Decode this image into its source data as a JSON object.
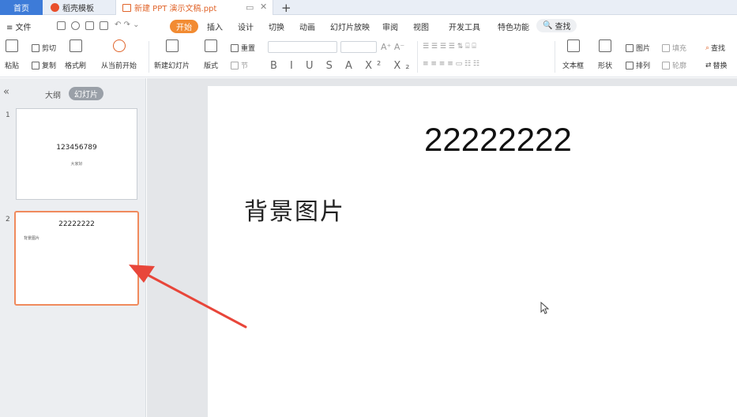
{
  "tabs": {
    "home": "首页",
    "templates": "稻壳模板",
    "document": "新建 PPT 演示文稿.ppt"
  },
  "menu": {
    "file": "≡ 文件",
    "start": "开始",
    "items": [
      "插入",
      "设计",
      "切换",
      "动画",
      "幻灯片放映",
      "审阅",
      "视图",
      "开发工具",
      "特色功能"
    ],
    "search": "查找"
  },
  "ribbon": {
    "paste": "粘贴",
    "cut": "剪切",
    "copy": "复制",
    "format_painter": "格式刷",
    "play_from_current": "从当前开始",
    "new_slide": "新建幻灯片",
    "layout": "版式",
    "section": "节",
    "reset": "重置",
    "text_box": "文本框",
    "shape": "形状",
    "picture": "图片",
    "arrange": "排列",
    "fill": "填充",
    "outline": "轮廓",
    "find": "查找",
    "replace": "替换"
  },
  "sidebar": {
    "outline_tab": "大纲",
    "slides_tab": "幻灯片",
    "slides": [
      {
        "number": "1",
        "title": "123456789",
        "subtitle": "大家好"
      },
      {
        "number": "2",
        "title": "22222222",
        "body": "背景图片"
      }
    ]
  },
  "slide": {
    "title": "22222222",
    "body": "背景图片"
  },
  "colors": {
    "accent": "#f28b32",
    "home_tab": "#3d7bd8",
    "selection": "#f08a5d",
    "annotation_arrow": "#e8463a"
  }
}
